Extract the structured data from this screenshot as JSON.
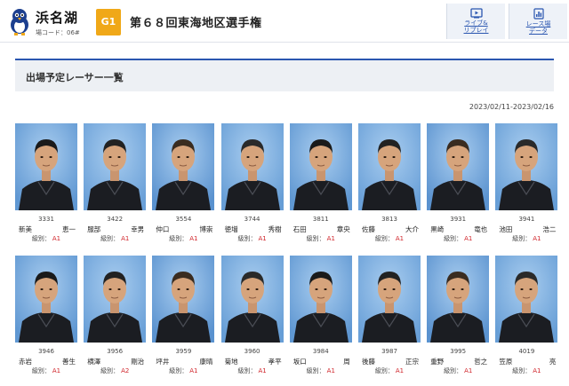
{
  "header": {
    "venue_name": "浜名湖",
    "venue_code": "場コード：06#",
    "grade": "G1",
    "race_title": "第６８回東海地区選手権",
    "live_button": [
      "ライブ&",
      "リプレイ"
    ],
    "data_button": [
      "レース場",
      "データ"
    ],
    "icons": {
      "live": "tv-play-icon",
      "data": "bar-chart-icon"
    },
    "colors": {
      "accent": "#2a56b0",
      "grade": "#f0a818",
      "rank": "#d0252b"
    }
  },
  "section": {
    "title": "出場予定レーサー一覧",
    "date_range": "2023/02/11-2023/02/16"
  },
  "rank_label": "級別：",
  "racers": [
    {
      "reg": "3331",
      "last": "新美",
      "first": "恵一",
      "rank": "A1"
    },
    {
      "reg": "3422",
      "last": "服部",
      "first": "幸男",
      "rank": "A1"
    },
    {
      "reg": "3554",
      "last": "仲口",
      "first": "博崇",
      "rank": "A1"
    },
    {
      "reg": "3744",
      "last": "徳増",
      "first": "秀樹",
      "rank": "A1"
    },
    {
      "reg": "3811",
      "last": "石田",
      "first": "章央",
      "rank": "A1"
    },
    {
      "reg": "3813",
      "last": "佐藤",
      "first": "大介",
      "rank": "A1"
    },
    {
      "reg": "3931",
      "last": "黒崎",
      "first": "竜也",
      "rank": "A1"
    },
    {
      "reg": "3941",
      "last": "池田",
      "first": "浩二",
      "rank": "A1"
    },
    {
      "reg": "3946",
      "last": "赤岩",
      "first": "善生",
      "rank": "A1"
    },
    {
      "reg": "3956",
      "last": "横澤",
      "first": "剛治",
      "rank": "A2"
    },
    {
      "reg": "3959",
      "last": "坪井",
      "first": "康晴",
      "rank": "A1"
    },
    {
      "reg": "3960",
      "last": "菊地",
      "first": "孝平",
      "rank": "A1"
    },
    {
      "reg": "3984",
      "last": "坂口",
      "first": "周",
      "rank": "A1"
    },
    {
      "reg": "3987",
      "last": "後藤",
      "first": "正宗",
      "rank": "A1"
    },
    {
      "reg": "3995",
      "last": "重野",
      "first": "哲之",
      "rank": "A1"
    },
    {
      "reg": "4019",
      "last": "笠原",
      "first": "亮",
      "rank": "A1"
    }
  ]
}
